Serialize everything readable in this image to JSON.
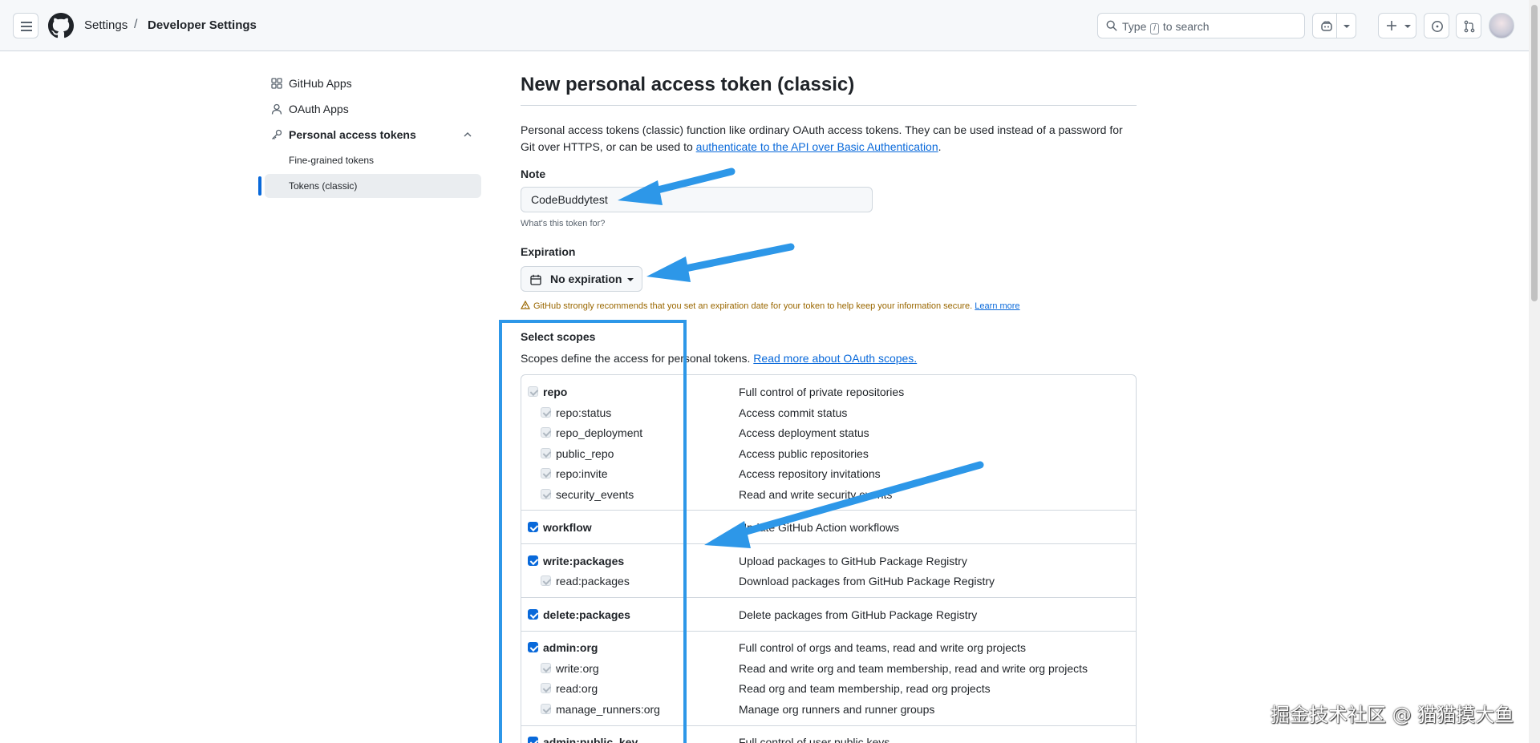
{
  "header": {
    "breadcrumb_settings": "Settings",
    "breadcrumb_separator": "/",
    "breadcrumb_current": "Developer Settings",
    "search_prefix": "Type",
    "search_key": "/",
    "search_suffix": "to search"
  },
  "sidebar": {
    "items": [
      {
        "label": "GitHub Apps",
        "icon": "apps-grid-icon"
      },
      {
        "label": "OAuth Apps",
        "icon": "person-icon"
      },
      {
        "label": "Personal access tokens",
        "icon": "key-icon"
      }
    ],
    "sub_items": [
      {
        "label": "Fine-grained tokens"
      },
      {
        "label": "Tokens (classic)",
        "active": true
      }
    ]
  },
  "main": {
    "title": "New personal access token (classic)",
    "intro_text": "Personal access tokens (classic) function like ordinary OAuth access tokens. They can be used instead of a password for Git over HTTPS, or can be used to ",
    "intro_link": "authenticate to the API over Basic Authentication",
    "intro_end": ".",
    "note_label": "Note",
    "note_value": "CodeBuddytest",
    "note_hint": "What's this token for?",
    "expiration_label": "Expiration",
    "expiration_value": "No expiration",
    "warning_text": "GitHub strongly recommends that you set an expiration date for your token to help keep your information secure.",
    "warning_link": "Learn more",
    "scopes_label": "Select scopes",
    "scopes_desc": "Scopes define the access for personal tokens.",
    "scopes_link": "Read more about OAuth scopes."
  },
  "scopes": [
    {
      "name": "repo",
      "desc": "Full control of private repositories",
      "level": 0,
      "state": "disabled"
    },
    {
      "name": "repo:status",
      "desc": "Access commit status",
      "level": 1,
      "state": "disabled"
    },
    {
      "name": "repo_deployment",
      "desc": "Access deployment status",
      "level": 1,
      "state": "disabled"
    },
    {
      "name": "public_repo",
      "desc": "Access public repositories",
      "level": 1,
      "state": "disabled"
    },
    {
      "name": "repo:invite",
      "desc": "Access repository invitations",
      "level": 1,
      "state": "disabled"
    },
    {
      "name": "security_events",
      "desc": "Read and write security events",
      "level": 1,
      "state": "disabled"
    },
    {
      "name": "workflow",
      "desc": "Update GitHub Action workflows",
      "level": 0,
      "state": "checked"
    },
    {
      "name": "write:packages",
      "desc": "Upload packages to GitHub Package Registry",
      "level": 0,
      "state": "checked"
    },
    {
      "name": "read:packages",
      "desc": "Download packages from GitHub Package Registry",
      "level": 1,
      "state": "disabled"
    },
    {
      "name": "delete:packages",
      "desc": "Delete packages from GitHub Package Registry",
      "level": 0,
      "state": "checked"
    },
    {
      "name": "admin:org",
      "desc": "Full control of orgs and teams, read and write org projects",
      "level": 0,
      "state": "checked"
    },
    {
      "name": "write:org",
      "desc": "Read and write org and team membership, read and write org projects",
      "level": 1,
      "state": "disabled"
    },
    {
      "name": "read:org",
      "desc": "Read org and team membership, read org projects",
      "level": 1,
      "state": "disabled"
    },
    {
      "name": "manage_runners:org",
      "desc": "Manage org runners and runner groups",
      "level": 1,
      "state": "disabled"
    },
    {
      "name": "admin:public_key",
      "desc": "Full control of user public keys",
      "level": 0,
      "state": "checked"
    }
  ],
  "watermark": "掘金技术社区 @ 猫猫摸大鱼",
  "colors": {
    "accent": "#0969da",
    "annotation": "#2d97e8",
    "warning": "#9a6700"
  }
}
